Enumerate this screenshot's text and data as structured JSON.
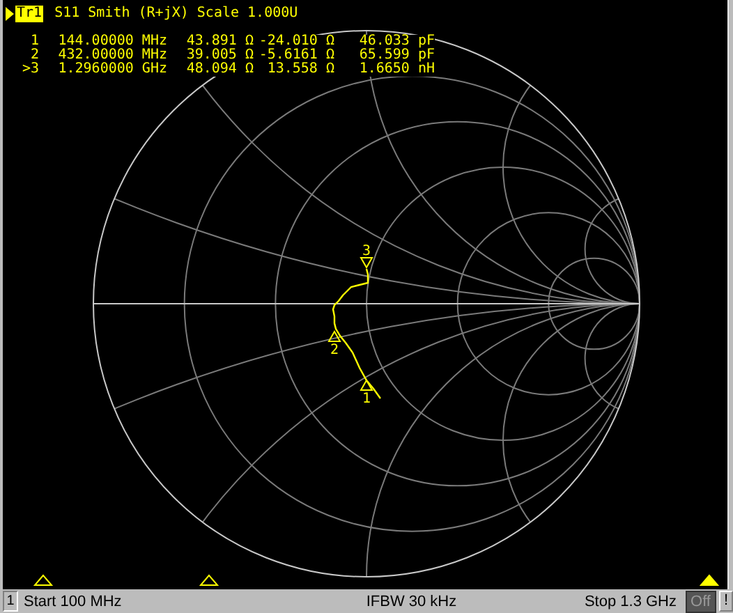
{
  "trace_header": {
    "trace": "Tr1",
    "text": "S11 Smith (R+jX) Scale 1.000U"
  },
  "marker_table": [
    {
      "id": "1",
      "frequency": "144.00000 MHz",
      "resistance": "43.891 Ω",
      "reactance": "-24.010 Ω",
      "value": "46.033 pF"
    },
    {
      "id": "2",
      "frequency": "432.00000 MHz",
      "resistance": "39.005 Ω",
      "reactance": "-5.6161 Ω",
      "value": "65.599 pF"
    },
    {
      "id": ">3",
      "frequency": "1.2960000 GHz",
      "resistance": "48.094 Ω",
      "reactance": "13.558 Ω",
      "value": "1.6650 nH"
    }
  ],
  "chart_markers": [
    {
      "label": "1"
    },
    {
      "label": "2"
    },
    {
      "label": "3"
    }
  ],
  "stimulus_markers": [
    {
      "active": false
    },
    {
      "active": false
    },
    {
      "active": true
    }
  ],
  "status_bar": {
    "channel": "1",
    "start": "Start 100 MHz",
    "ifbw": "IFBW 30 kHz",
    "stop": "Stop 1.3 GHz",
    "toggle": "Off",
    "alert": "!"
  }
}
